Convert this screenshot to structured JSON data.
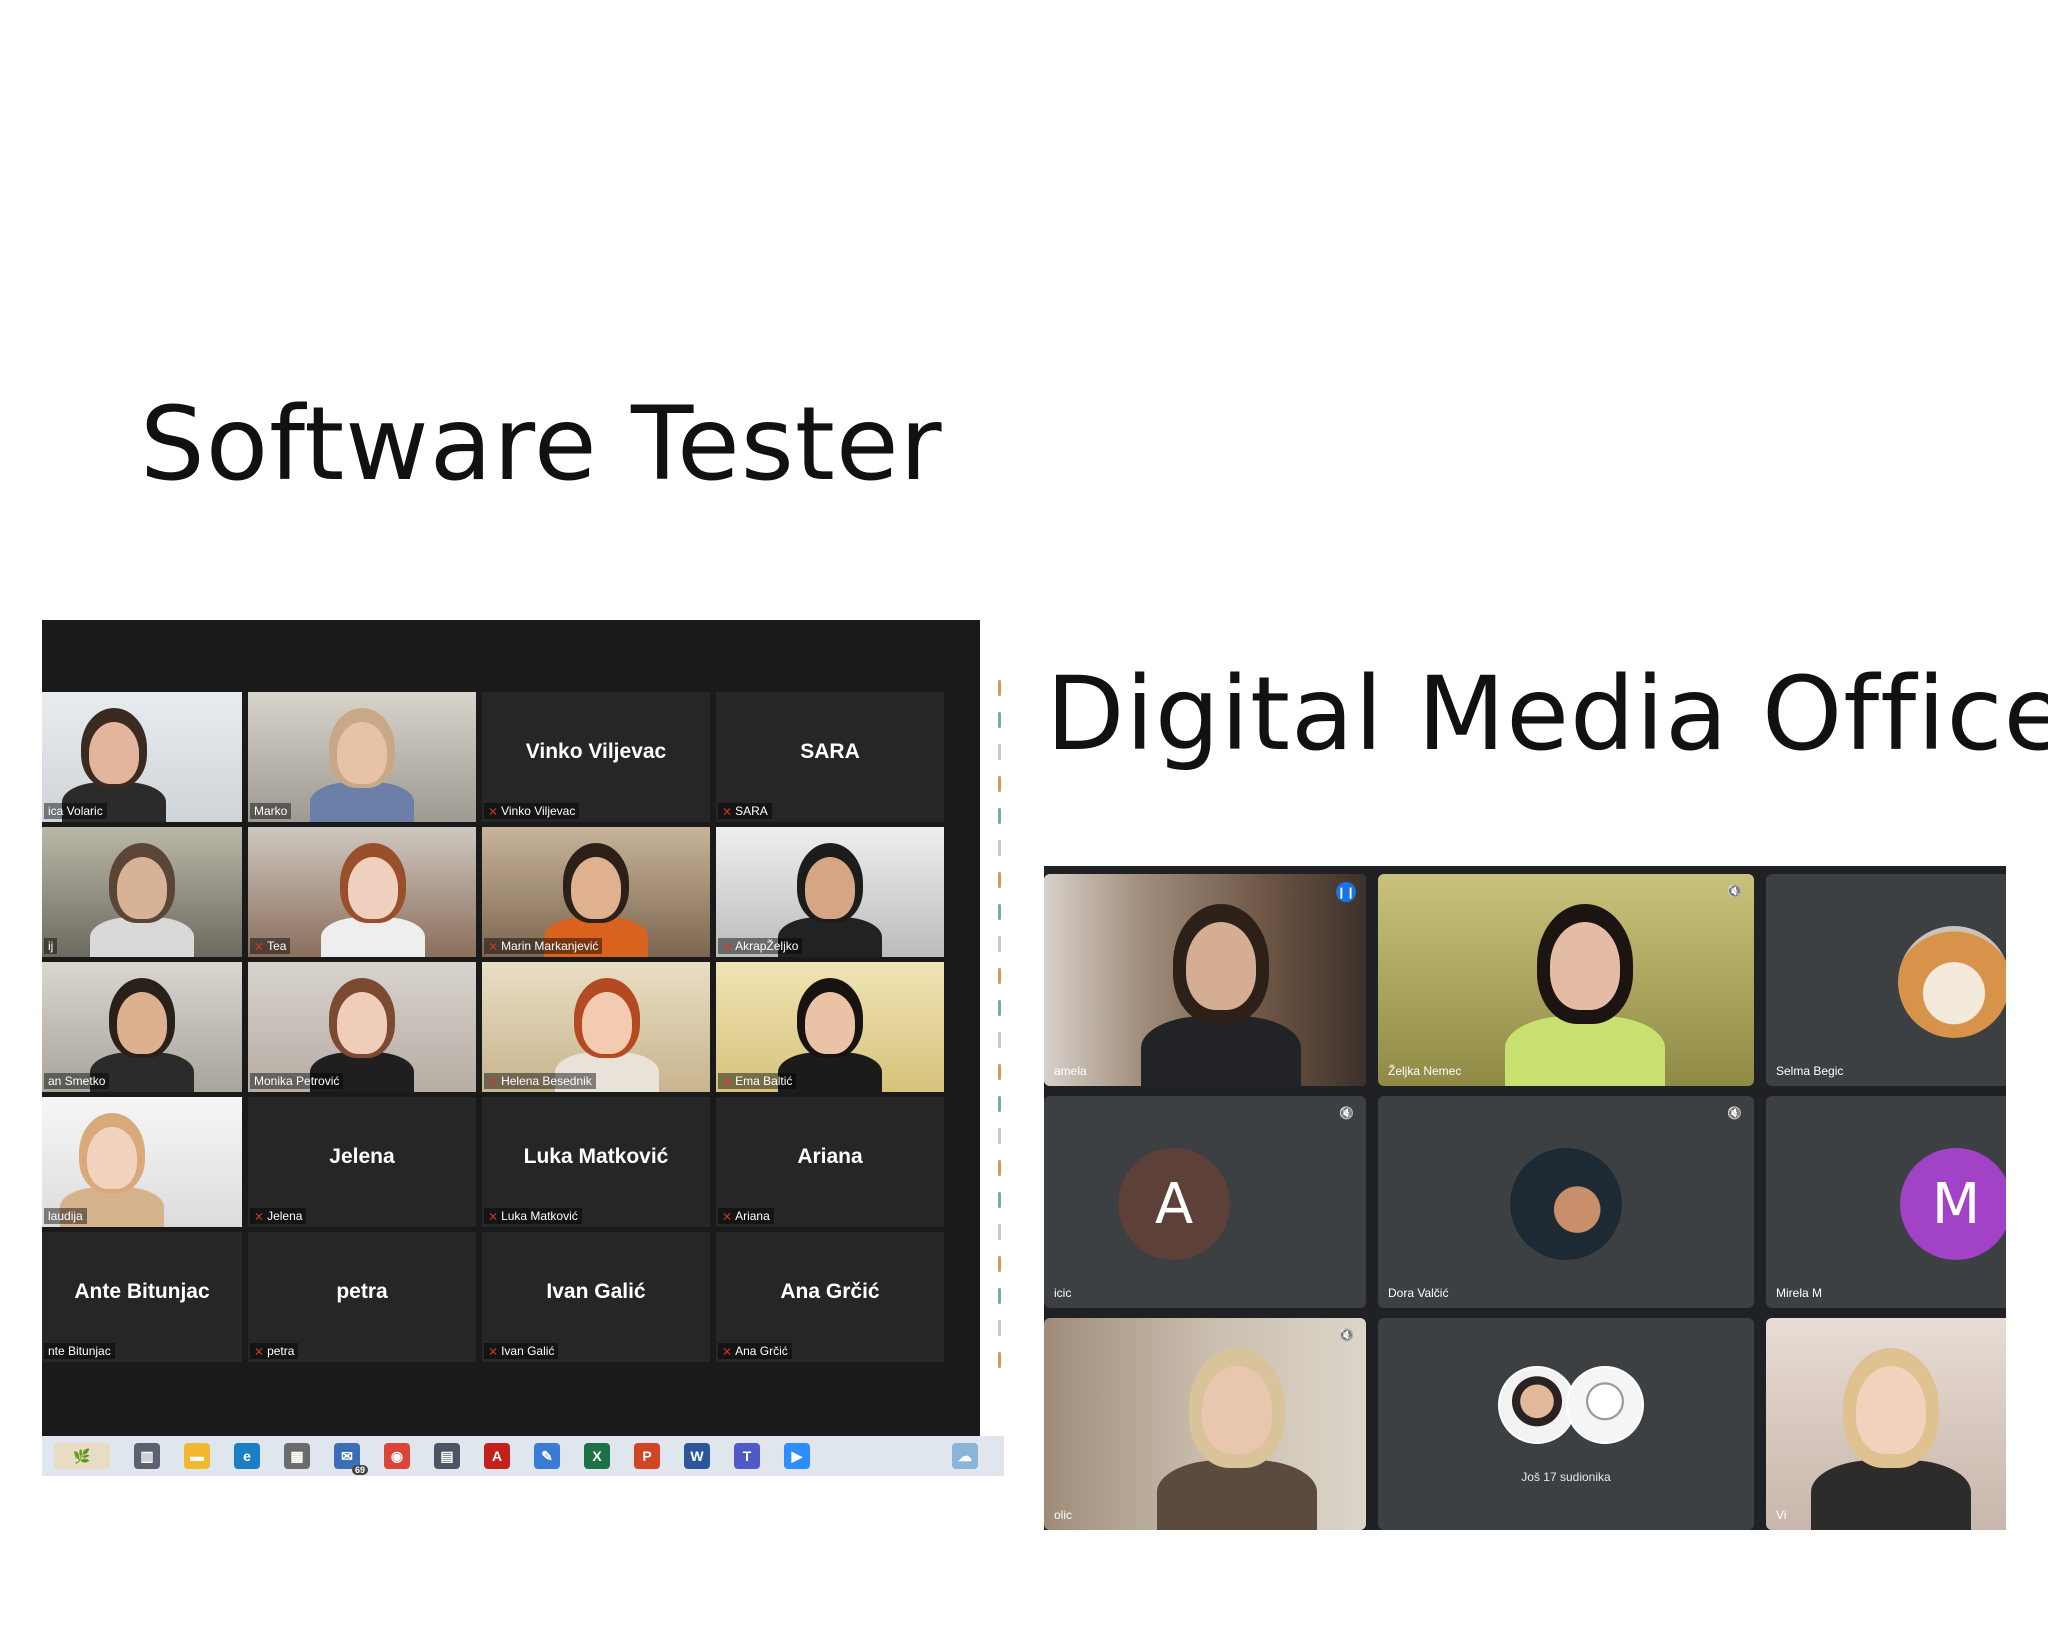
{
  "headings": {
    "left": "Software Tester",
    "right": "Digital Media Officer"
  },
  "zoom": {
    "tiles": [
      {
        "label": "ica Volaric",
        "big": "",
        "muted": false,
        "video": "woman-red-glasses"
      },
      {
        "label": "Marko",
        "big": "",
        "muted": false,
        "video": "man-shirt"
      },
      {
        "label": "Vinko Viljevac",
        "big": "Vinko Viljevac",
        "muted": true,
        "video": ""
      },
      {
        "label": "SARA",
        "big": "SARA",
        "muted": true,
        "video": ""
      },
      {
        "label": "ij",
        "big": "",
        "muted": false,
        "video": "man-chair"
      },
      {
        "label": "Tea",
        "big": "",
        "muted": true,
        "video": "woman-red-hair"
      },
      {
        "label": "Marin Markanjević",
        "big": "",
        "muted": true,
        "video": "man-headset"
      },
      {
        "label": "AkrapŽeljko",
        "big": "",
        "muted": true,
        "video": "man-headset-dark"
      },
      {
        "label": "an Smetko",
        "big": "",
        "muted": false,
        "video": "man-glasses"
      },
      {
        "label": "Monika Petrović",
        "big": "",
        "muted": false,
        "video": "woman-glasses"
      },
      {
        "label": "Helena Besednik",
        "big": "",
        "muted": true,
        "video": "woman-redhead"
      },
      {
        "label": "Ema Baltić",
        "big": "",
        "muted": true,
        "video": "woman-dark-hair"
      },
      {
        "label": "laudija",
        "big": "",
        "muted": false,
        "video": "woman-bright"
      },
      {
        "label": "Jelena",
        "big": "Jelena",
        "muted": true,
        "video": ""
      },
      {
        "label": "Luka Matković",
        "big": "Luka Matković",
        "muted": true,
        "video": ""
      },
      {
        "label": "Ariana",
        "big": "Ariana",
        "muted": true,
        "video": ""
      },
      {
        "label": "nte Bitunjac",
        "big": "Ante Bitunjac",
        "muted": false,
        "video": ""
      },
      {
        "label": "petra",
        "big": "petra",
        "muted": true,
        "video": ""
      },
      {
        "label": "Ivan Galić",
        "big": "Ivan Galić",
        "muted": true,
        "video": ""
      },
      {
        "label": "Ana Grčić",
        "big": "Ana Grčić",
        "muted": true,
        "video": ""
      }
    ],
    "taskbar": {
      "icons": [
        "search-icon",
        "task-view-icon",
        "file-explorer-icon",
        "edge-icon",
        "store-icon",
        "mail-icon",
        "chrome-icon",
        "calculator-icon",
        "acrobat-icon",
        "notepad-icon",
        "excel-icon",
        "powerpoint-icon",
        "word-icon",
        "teams-icon",
        "zoom-icon",
        "weather-icon"
      ],
      "mail_badge": "69"
    }
  },
  "meet": {
    "tiles": [
      {
        "label": "amela",
        "avatar": "",
        "avatar_color": "",
        "speaking": true,
        "muted": false
      },
      {
        "label": "Željka Nemec",
        "avatar": "",
        "avatar_color": "",
        "speaking": false,
        "muted": true
      },
      {
        "label": "Selma Begic",
        "avatar": "",
        "avatar_color": "",
        "speaking": false,
        "muted": false
      },
      {
        "label": "icic",
        "avatar": "A",
        "avatar_color": "#5d4037",
        "speaking": false,
        "muted": true
      },
      {
        "label": "Dora Valčić",
        "avatar": "",
        "avatar_color": "",
        "speaking": false,
        "muted": true
      },
      {
        "label": "Mirela M",
        "avatar": "M",
        "avatar_color": "#a142c7",
        "speaking": false,
        "muted": false
      },
      {
        "label": "olic",
        "avatar": "",
        "avatar_color": "",
        "speaking": false,
        "muted": true
      },
      {
        "label": "",
        "avatar": "",
        "avatar_color": "",
        "speaking": false,
        "muted": false,
        "more": "Još 17 sudionika"
      },
      {
        "label": "Vi",
        "avatar": "",
        "avatar_color": "",
        "speaking": false,
        "muted": false
      }
    ]
  }
}
